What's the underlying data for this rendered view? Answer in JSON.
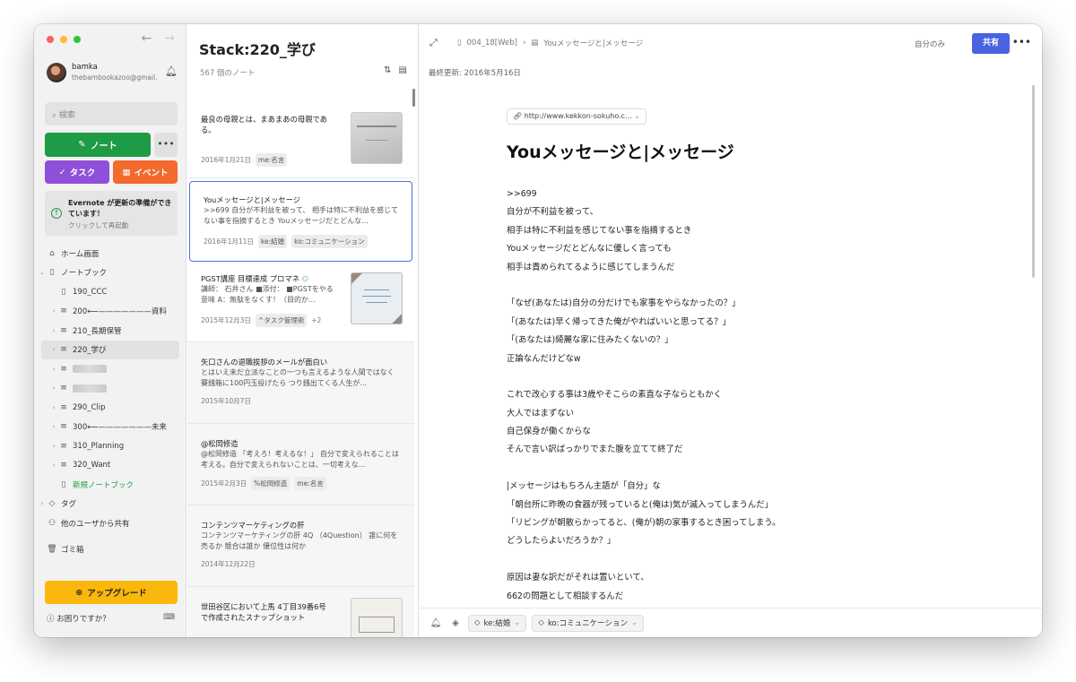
{
  "sidebar": {
    "user_name": "bamka",
    "user_email": "thebambookazoo@gmail....",
    "search_placeholder": "検索",
    "note_button": "ノート",
    "more_button": "•••",
    "task_button": "タスク",
    "event_button": "イベント",
    "update_title": "Evernote が更新の準備ができています！",
    "update_sub": "クリックして再起動",
    "nav": [
      {
        "label": "ホーム画面"
      },
      {
        "label": "ノートブック"
      },
      {
        "label": "190_CCC"
      },
      {
        "label": "200⟵———————資料"
      },
      {
        "label": "210_長期保管"
      },
      {
        "label": "220_学び"
      },
      {
        "label": ""
      },
      {
        "label": ""
      },
      {
        "label": "290_Clip"
      },
      {
        "label": "300⟵———————未来"
      },
      {
        "label": "310_Planning"
      },
      {
        "label": "320_Want"
      },
      {
        "label": "新規ノートブック"
      },
      {
        "label": "タグ"
      },
      {
        "label": "他のユーザから共有"
      },
      {
        "label": "ゴミ箱"
      }
    ],
    "upgrade_button": "アップグレード",
    "help": "お困りですか？"
  },
  "list": {
    "title": "Stack:220_学び",
    "count": "567 個のノート",
    "notes": [
      {
        "title": "最良の母親とは、まあまあの母親であ",
        "body": "る。",
        "date": "2016年1月21日",
        "tags": [
          "me:名言"
        ]
      },
      {
        "title": "Youメッセージと|メッセージ",
        "body": ">>699 自分が不利益を被って、 相手は特に不利益を感じてない事を指摘するとき Youメッセージだとどんな...",
        "date": "2016年1月11日",
        "tags": [
          "ke:結婚",
          "ko:コミュニケーション"
        ]
      },
      {
        "title": "PGST講座 目標達成 プロマネ",
        "body": "講師： 石井さん ■添付： ■PGSTをやる意味 A：無駄をなくす！（目的か...",
        "date": "2015年12月3日",
        "tags": [
          "^タスク管理術"
        ],
        "extra": "+2"
      },
      {
        "title": "矢口さんの退職挨拶のメールが面白い",
        "body": "とはいえ未だ立派なことの一つも言えるような人間ではなく 賽銭箱に100円玉投げたら つり銭出てくる人生が...",
        "date": "2015年10月7日",
        "tags": []
      },
      {
        "title": "@松岡修造",
        "body": "@松岡修造 「考えろ！考えるな！」 自分で変えられることは考える。自分で変えられないことは、一切考えな...",
        "date": "2015年2月3日",
        "tags": [
          "%松岡修造",
          "me:名言"
        ]
      },
      {
        "title": "コンテンツマーケティングの肝",
        "body": "コンテンツマーケティングの肝 4Q （4Question） 誰に何を売るか 競合は誰か 優位性は何か",
        "date": "2014年12月22日",
        "tags": []
      },
      {
        "title": "世田谷区において上馬 4丁目39番6号",
        "body": "で作成されたスナップショット",
        "date": "",
        "tags": []
      }
    ]
  },
  "editor": {
    "breadcrumb_notebook": "004_18[Web]",
    "breadcrumb_note": "Youメッセージと|メッセージ",
    "visibility": "自分のみ",
    "share_button": "共有",
    "updated": "最終更新: 2016年5月16日",
    "url": "http://www.kekkon-sokuho.c...",
    "title": "Youメッセージと|メッセージ",
    "lines": [
      ">>699",
      "自分が不利益を被って、",
      "相手は特に不利益を感じてない事を指摘するとき",
      "Youメッセージだとどんなに優しく言っても",
      "相手は責められてるように感じてしまうんだ",
      "",
      "「なぜ(あなたは)自分の分だけでも家事をやらなかったの？」",
      "「(あなたは)早く帰ってきた俺がやればいいと思ってる？」",
      "「(あなたは)綺麗な家に住みたくないの？」",
      "正論なんだけどなw",
      "",
      "これで改心する事は3歳やそこらの素直な子ならともかく",
      "大人ではまずない",
      "自己保身が働くからな",
      "そんで言い訳ばっかりでまた腹を立てて終了だ",
      "",
      "|メッセージはもちろん主語が「自分」な",
      "「朝台所に昨晩の食器が残っていると(俺は)気が滅入ってしまうんだ」",
      "「リビングが朝散らかってると、(俺が)朝の家事するとき困ってしまう。",
      "どうしたらよいだろうか？」",
      "",
      "原因は妻な訳だがそれは置いといて、",
      "662の問題として相談するんだ"
    ],
    "tags": [
      "ke:結婚",
      "ko:コミュニケーション"
    ]
  },
  "colors": {
    "note_green": "#1e9b45",
    "task_purple": "#8f4fd9",
    "event_orange": "#f26a2e",
    "upgrade_yellow": "#fbb80c",
    "share_blue": "#4a63e0"
  }
}
